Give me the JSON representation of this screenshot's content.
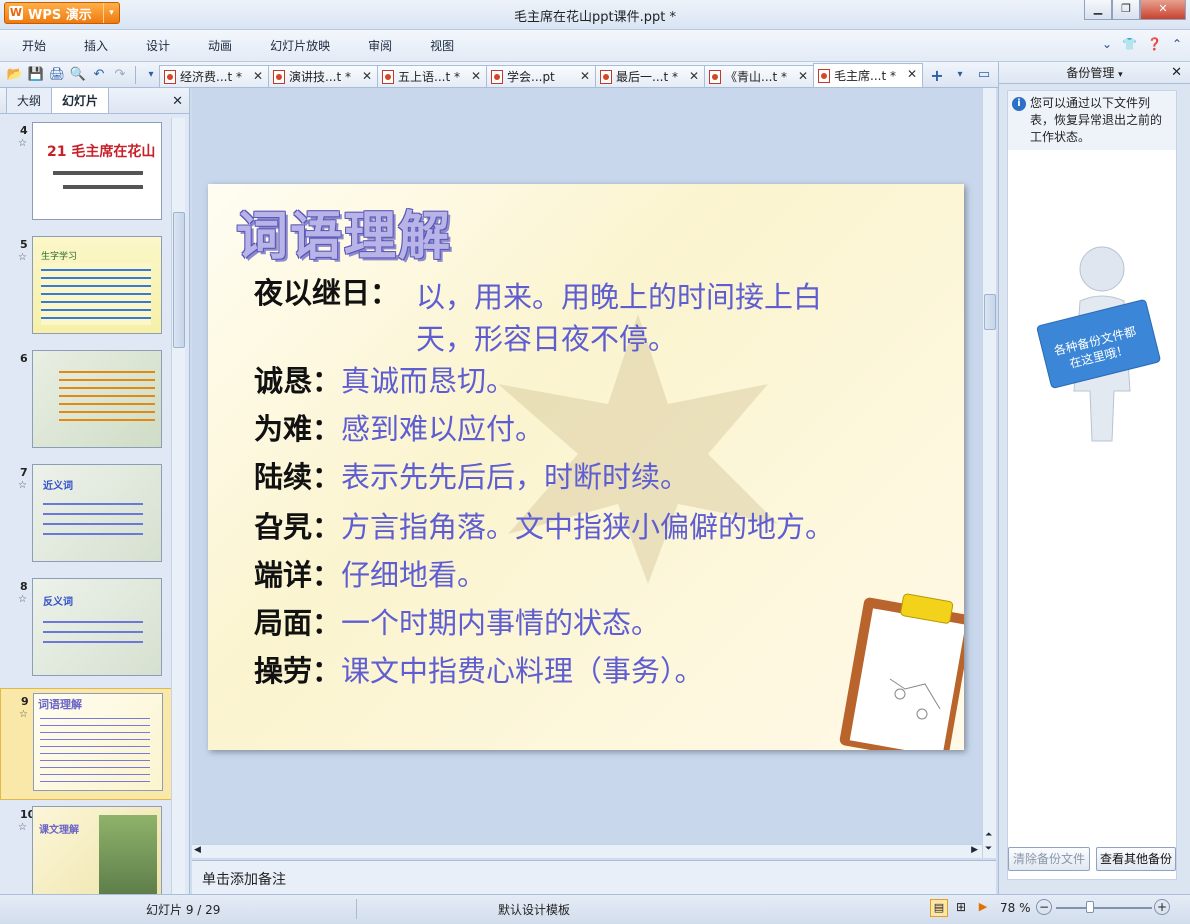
{
  "app": {
    "brand": "WPS 演示",
    "window_title": "毛主席在花山ppt课件.ppt *"
  },
  "menu": [
    "开始",
    "插入",
    "设计",
    "动画",
    "幻灯片放映",
    "审阅",
    "视图"
  ],
  "doc_tabs": [
    {
      "label": "经济费...t *"
    },
    {
      "label": "演讲技...t *"
    },
    {
      "label": "五上语...t *"
    },
    {
      "label": "学会...pt"
    },
    {
      "label": "最后一...t *"
    },
    {
      "label": "《青山...t *"
    },
    {
      "label": "毛主席...t *",
      "active": true
    }
  ],
  "left_panel": {
    "tabs": [
      "大纲",
      "幻灯片"
    ],
    "active_tab": "幻灯片",
    "thumbnails": [
      {
        "num": "4",
        "title": "21 毛主席在花山"
      },
      {
        "num": "5",
        "title": "生字学习"
      },
      {
        "num": "6",
        "title": ""
      },
      {
        "num": "7",
        "title": "近义词"
      },
      {
        "num": "8",
        "title": "反义词"
      },
      {
        "num": "9",
        "title": "词语理解",
        "selected": true
      },
      {
        "num": "10",
        "title": "课文理解"
      }
    ]
  },
  "slide": {
    "title": "词语理解",
    "entries": [
      {
        "term": "夜以继日：",
        "def_line1": "以，用来。用晚上的时间接上白",
        "def_line2": "天，形容日夜不停。"
      },
      {
        "term": "诚恳：",
        "def": "真诚而恳切。"
      },
      {
        "term": "为难：",
        "def": "感到难以应付。"
      },
      {
        "term": "陆续：",
        "def": "表示先先后后，时断时续。"
      },
      {
        "term": "旮旯：",
        "def": "方言指角落。文中指狭小偏僻的地方。"
      },
      {
        "term": "端详：",
        "def": "仔细地看。"
      },
      {
        "term": "局面：",
        "def": "一个时期内事情的状态。"
      },
      {
        "term": "操劳：",
        "def": "课文中指费心料理（事务）。"
      }
    ]
  },
  "notes": {
    "placeholder": "单击添加备注"
  },
  "backup_panel": {
    "title": "备份管理",
    "info": "您可以通过以下文件列表，恢复异常退出之前的工作状态。",
    "sign_text": "各种备份文件都在这里哦！",
    "btn_clear": "清除备份文件",
    "btn_view": "查看其他备份"
  },
  "status": {
    "slide_pos": "幻灯片 9 / 29",
    "template": "默认设计模板",
    "zoom": "78 %"
  },
  "colors": {
    "accent": "#2d5fa8",
    "slide_term": "#111111",
    "slide_def": "#5e5ed2",
    "wps_orange": "#f07a10"
  }
}
